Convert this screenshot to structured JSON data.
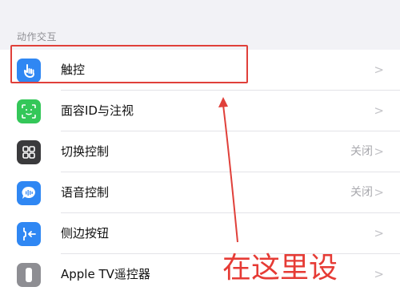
{
  "section_header": "动作交互",
  "rows": [
    {
      "label": "触控",
      "value": "",
      "chevron": ">",
      "icon": "touch-hand-icon",
      "icon_color": "#2f87f3"
    },
    {
      "label": "面容ID与注视",
      "value": "",
      "chevron": ">",
      "icon": "face-id-icon",
      "icon_color": "#34c759"
    },
    {
      "label": "切换控制",
      "value": "关闭",
      "chevron": ">",
      "icon": "switch-control-icon",
      "icon_color": "#3a3a3c"
    },
    {
      "label": "语音控制",
      "value": "关闭",
      "chevron": ">",
      "icon": "voice-control-icon",
      "icon_color": "#2f87f3"
    },
    {
      "label": "侧边按钮",
      "value": "",
      "chevron": ">",
      "icon": "side-button-icon",
      "icon_color": "#2f87f3"
    },
    {
      "label": "Apple TV遥控器",
      "value": "",
      "chevron": ">",
      "icon": "remote-icon",
      "icon_color": "#8e8e93"
    }
  ],
  "annotation": {
    "text": "在这里设",
    "color": "#e63b35"
  }
}
